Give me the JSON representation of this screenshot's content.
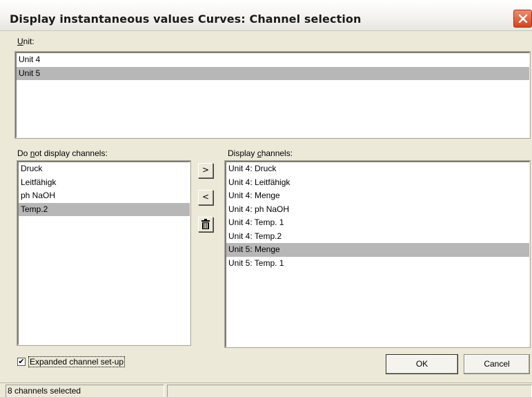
{
  "window": {
    "title": "Display instantaneous values Curves: Channel selection"
  },
  "unit_section": {
    "label_accel": "U",
    "label_rest": "nit:",
    "items": [
      "Unit 4",
      "Unit 5"
    ],
    "selected_index": 1
  },
  "hidden_section": {
    "label_pre": "Do ",
    "label_accel": "n",
    "label_post": "ot display channels:",
    "items": [
      "Druck",
      "Leitfähigk",
      "ph NaOH",
      "Temp.2"
    ],
    "selected_index": 3
  },
  "shown_section": {
    "label_pre": "Display ",
    "label_accel": "c",
    "label_post": "hannels:",
    "items": [
      "Unit 4:  Druck",
      "Unit 4:  Leitfähigk",
      "Unit 4:  Menge",
      "Unit 4:  ph NaOH",
      "Unit 4:  Temp. 1",
      "Unit 4:  Temp.2",
      "Unit 5:  Menge",
      "Unit 5:  Temp. 1"
    ],
    "selected_index": 6
  },
  "buttons": {
    "add": ">",
    "remove": "<",
    "delete_icon": "trash-icon",
    "ok": "OK",
    "cancel": "Cancel"
  },
  "options": {
    "expanded_label": "Expanded channel set-up",
    "expanded_checked": true
  },
  "status": {
    "text": "8 channels selected"
  }
}
